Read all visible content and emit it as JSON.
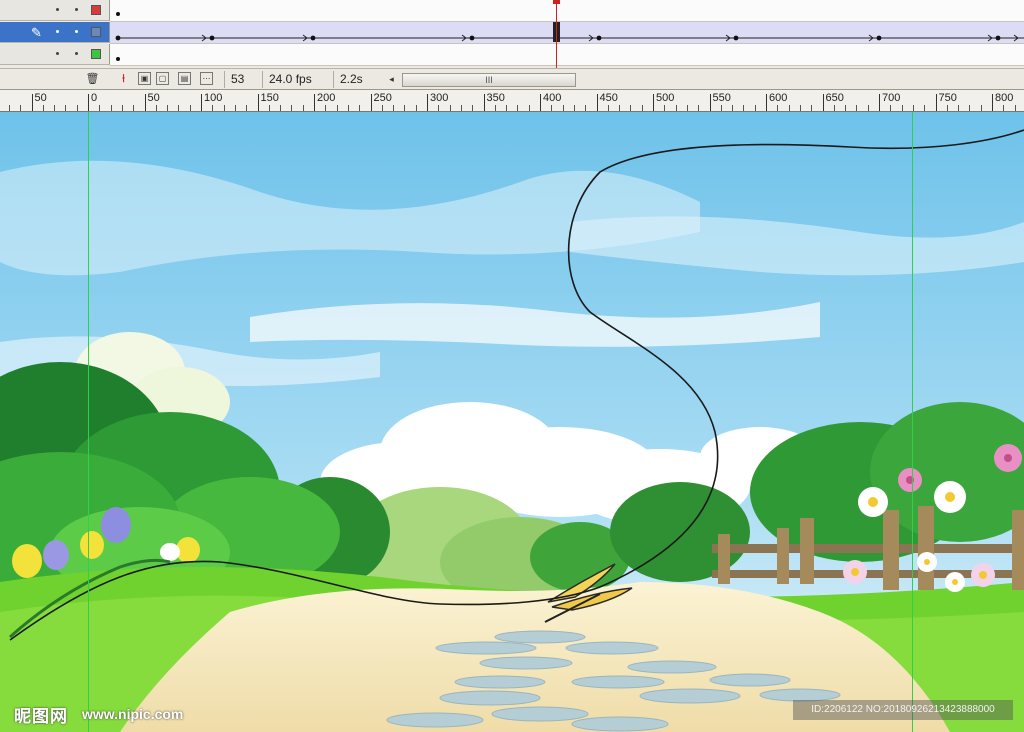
{
  "timeline": {
    "layers": [
      {
        "swatch_color": "#d93a3a",
        "selected": false,
        "has_tween": false
      },
      {
        "swatch_color": "#6e86b8",
        "selected": true,
        "has_tween": true
      },
      {
        "swatch_color": "#3ec43e",
        "selected": false,
        "has_tween": false
      }
    ],
    "keyframe_positions": [
      118,
      212,
      313,
      472,
      599,
      736,
      879,
      998
    ],
    "icons": [
      "trash-icon",
      "pencil-icon",
      "lock-dot",
      "eye-dot"
    ]
  },
  "status": {
    "current_frame": "53",
    "frame_rate": "24.0 fps",
    "elapsed_time": "2.2s",
    "scroll_grip": "III"
  },
  "ruler": {
    "labels": [
      "50",
      "0",
      "50",
      "100",
      "150",
      "200",
      "250",
      "300",
      "350",
      "400",
      "450",
      "500",
      "550",
      "600",
      "650",
      "700",
      "750",
      "800"
    ]
  },
  "watermark": {
    "logo_text": "昵图网",
    "url_text": "www.nipic.com",
    "id_text": "ID:2206122 NO:20180926213423888000"
  },
  "colors": {
    "sky": "#8fd0ee",
    "grass": "#6fd22e",
    "path": "#f3e6b8",
    "selection": "#3b73c8",
    "playhead": "#cc2222",
    "guide": "#2fd04a"
  }
}
